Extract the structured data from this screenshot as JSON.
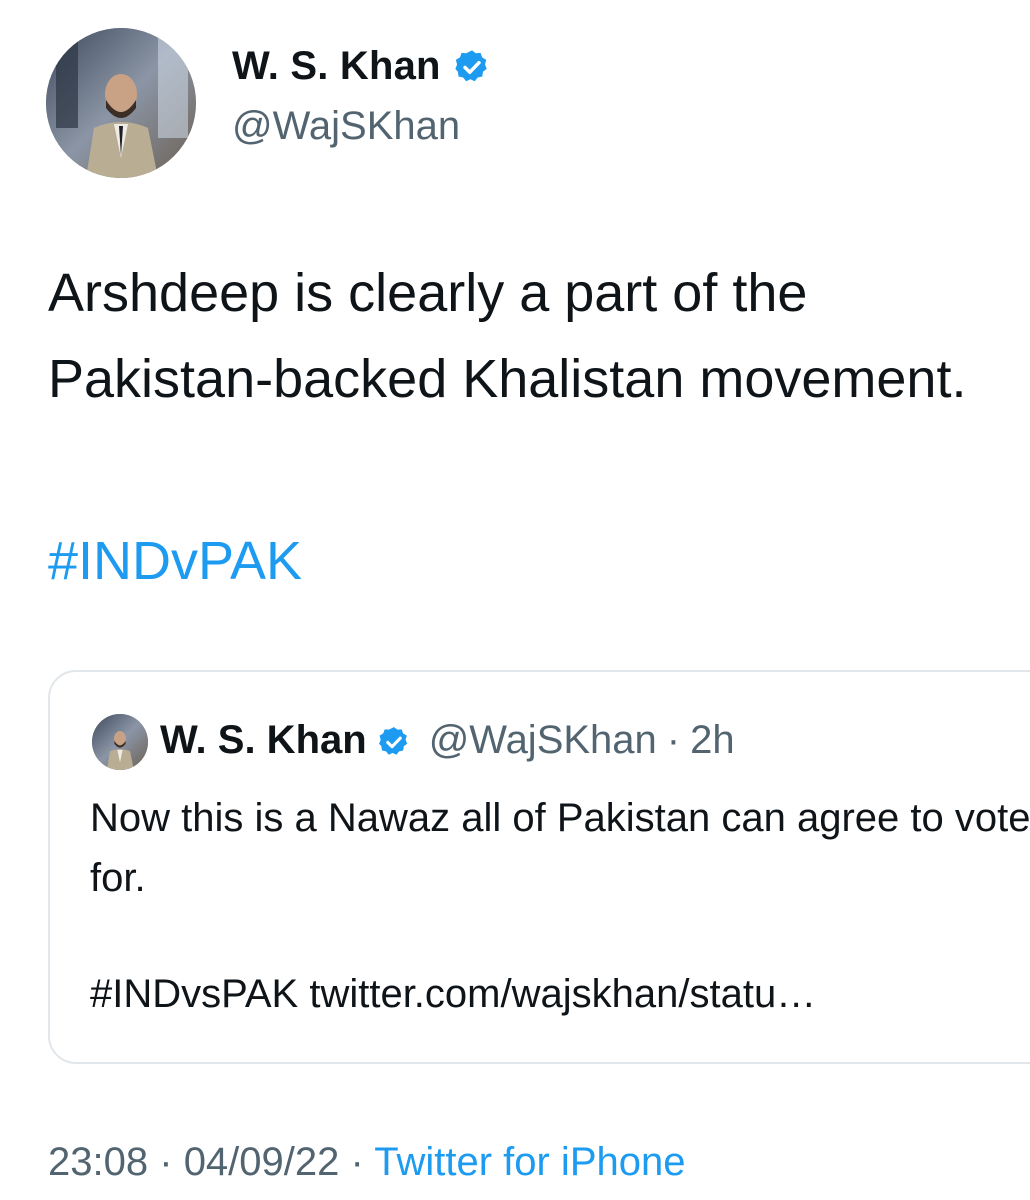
{
  "author": {
    "display_name": "W. S. Khan",
    "handle": "@WajSKhan",
    "verified": true
  },
  "tweet": {
    "text": "Arshdeep is clearly a part of the Pakistan-backed Khalistan movement.",
    "hashtag": "#INDvPAK"
  },
  "quoted_tweet": {
    "display_name": "W. S. Khan",
    "handle": "@WajSKhan",
    "separator": "·",
    "time": "2h",
    "text": "Now this is a Nawaz all of Pakistan can agree to vote for.",
    "hashtag": "#INDvsPAK",
    "link": "twitter.com/wajskhan/statu…"
  },
  "footer": {
    "time": "23:08",
    "sep1": "·",
    "date": "04/09/22",
    "sep2": "·",
    "source": "Twitter for iPhone"
  },
  "colors": {
    "link": "#1d9bf0",
    "secondary_text": "#536471",
    "primary_text": "#0f1419",
    "card_border": "#e1e6ea"
  },
  "icons": {
    "verified": "verified-badge-icon"
  }
}
